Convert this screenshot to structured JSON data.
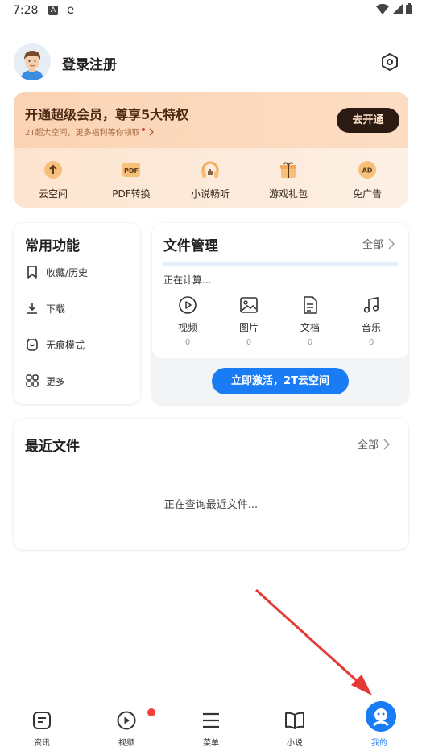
{
  "status_bar": {
    "time": "7:28",
    "icon_a": "A",
    "icon_e": "e"
  },
  "header": {
    "login_text": "登录注册"
  },
  "vip": {
    "title": "开通超级会员，尊享5大特权",
    "subtitle": "2T超大空间，更多福利等你领取",
    "button": "去开通",
    "perks": [
      {
        "label": "云空间",
        "icon": "cloud-upload-icon"
      },
      {
        "label": "PDF转换",
        "icon": "pdf-icon",
        "icon_text": "PDF"
      },
      {
        "label": "小说畅听",
        "icon": "headphones-icon"
      },
      {
        "label": "游戏礼包",
        "icon": "gift-icon"
      },
      {
        "label": "免广告",
        "icon": "ad-free-icon",
        "icon_text": "AD"
      }
    ]
  },
  "common": {
    "title": "常用功能",
    "items": [
      {
        "label": "收藏/历史",
        "icon": "bookmark-icon"
      },
      {
        "label": "下载",
        "icon": "download-icon"
      },
      {
        "label": "无痕模式",
        "icon": "incognito-icon"
      },
      {
        "label": "更多",
        "icon": "grid-icon"
      }
    ]
  },
  "file_mgmt": {
    "title": "文件管理",
    "all": "全部",
    "status": "正在计算...",
    "types": [
      {
        "label": "视频",
        "count": "0",
        "icon": "video-play-icon"
      },
      {
        "label": "图片",
        "count": "0",
        "icon": "image-icon"
      },
      {
        "label": "文档",
        "count": "0",
        "icon": "document-icon"
      },
      {
        "label": "音乐",
        "count": "0",
        "icon": "music-icon"
      }
    ],
    "activate": "立即激活，2T云空间"
  },
  "recent": {
    "title": "最近文件",
    "all": "全部",
    "empty": "正在查询最近文件..."
  },
  "nav": [
    {
      "label": "资讯",
      "icon": "news-icon"
    },
    {
      "label": "视频",
      "icon": "video-icon"
    },
    {
      "label": "菜单",
      "icon": "menu-icon"
    },
    {
      "label": "小说",
      "icon": "book-icon"
    },
    {
      "label": "我的",
      "icon": "me-icon"
    }
  ],
  "colors": {
    "accent": "#1a7cf5",
    "vip_dark": "#2a1a12",
    "annotation_red": "#e53935"
  }
}
